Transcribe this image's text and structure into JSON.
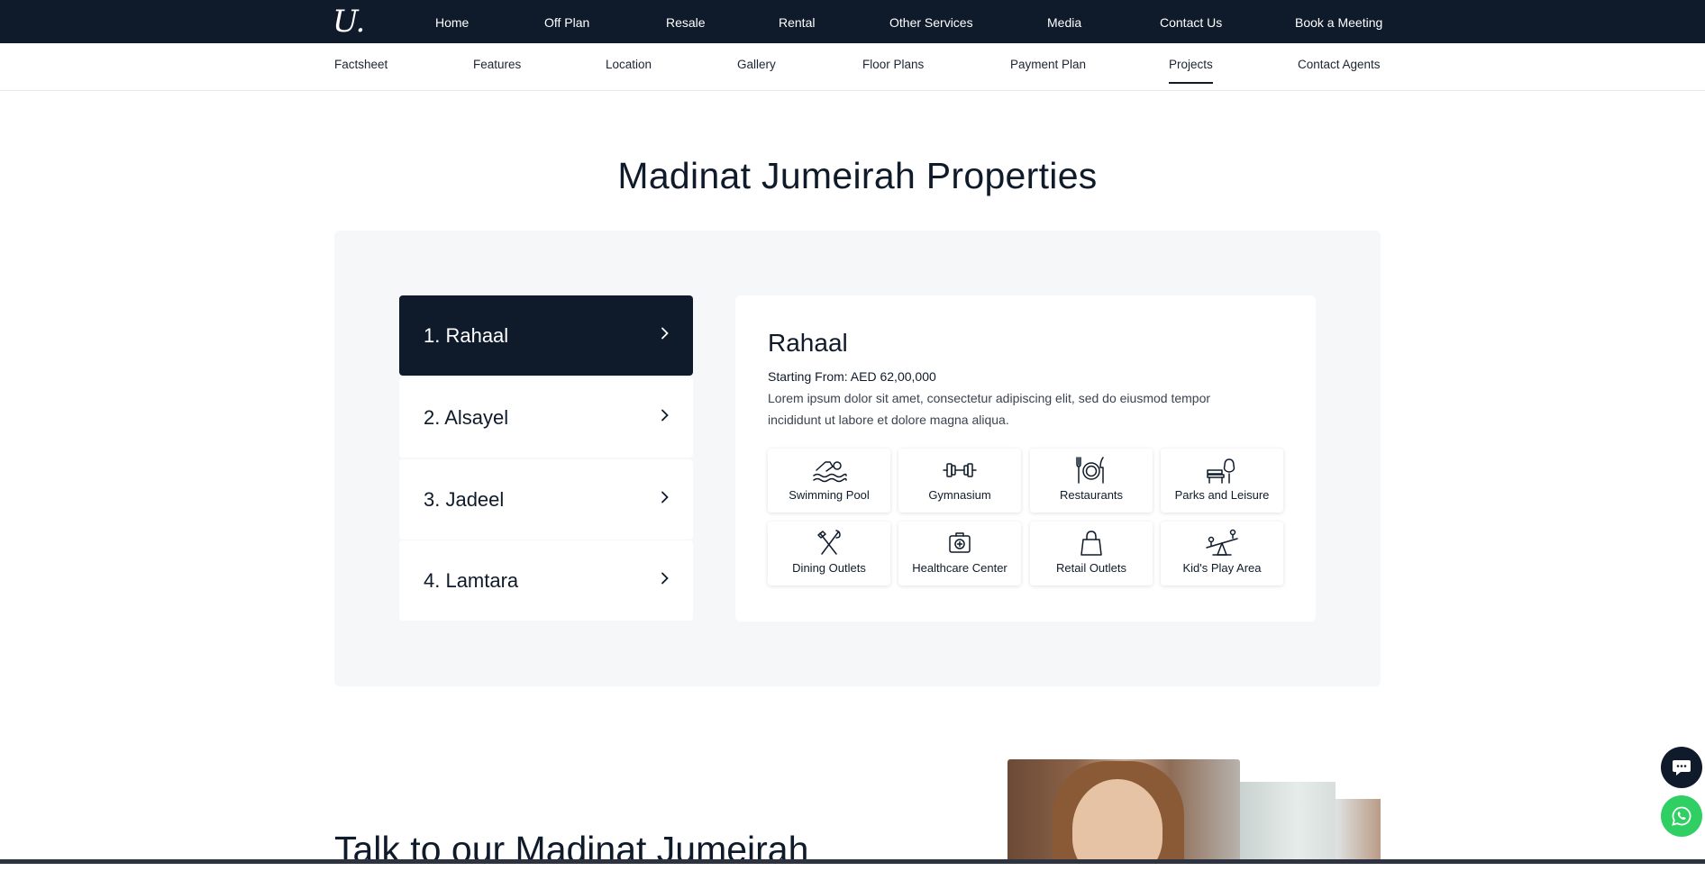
{
  "brand": {
    "logo_text": "U."
  },
  "top_nav": [
    {
      "label": "Home"
    },
    {
      "label": "Off Plan"
    },
    {
      "label": "Resale"
    },
    {
      "label": "Rental"
    },
    {
      "label": "Other Services"
    },
    {
      "label": "Media"
    },
    {
      "label": "Contact Us"
    },
    {
      "label": "Book a Meeting"
    }
  ],
  "sub_nav": [
    {
      "label": "Factsheet"
    },
    {
      "label": "Features"
    },
    {
      "label": "Location"
    },
    {
      "label": "Gallery"
    },
    {
      "label": "Floor Plans"
    },
    {
      "label": "Payment Plan"
    },
    {
      "label": "Projects",
      "active": true
    },
    {
      "label": "Contact Agents"
    }
  ],
  "section": {
    "title": "Madinat Jumeirah Properties"
  },
  "projects": [
    {
      "label": "1. Rahaal",
      "active": true
    },
    {
      "label": "2. Alsayel"
    },
    {
      "label": "3. Jadeel"
    },
    {
      "label": "4. Lamtara"
    }
  ],
  "chevron_icon": "chevron-right-icon",
  "detail": {
    "title": "Rahaal",
    "price": "Starting From: AED 62,00,000",
    "description": "Lorem ipsum dolor sit amet, consectetur adipiscing elit, sed do eiusmod tempor incididunt ut labore et dolore magna aliqua.",
    "amenities": [
      {
        "label": "Swimming Pool",
        "icon": "swimming-pool-icon"
      },
      {
        "label": "Gymnasium",
        "icon": "dumbbell-icon"
      },
      {
        "label": "Restaurants",
        "icon": "plate-cutlery-icon"
      },
      {
        "label": "Parks and Leisure",
        "icon": "park-bench-icon"
      },
      {
        "label": "Dining Outlets",
        "icon": "fork-knife-icon"
      },
      {
        "label": "Healthcare Center",
        "icon": "medical-kit-icon"
      },
      {
        "label": "Retail Outlets",
        "icon": "shopping-bag-icon"
      },
      {
        "label": "Kid's Play Area",
        "icon": "seesaw-icon"
      }
    ]
  },
  "talk": {
    "heading": "Talk to our Madinat Jumeirah"
  },
  "floating": {
    "chat_icon": "chat-bubble-icon",
    "whatsapp_icon": "whatsapp-icon"
  },
  "colors": {
    "navy": "#0f1b2a",
    "panel_bg": "#f6f7f9",
    "whatsapp": "#2fcf63"
  }
}
